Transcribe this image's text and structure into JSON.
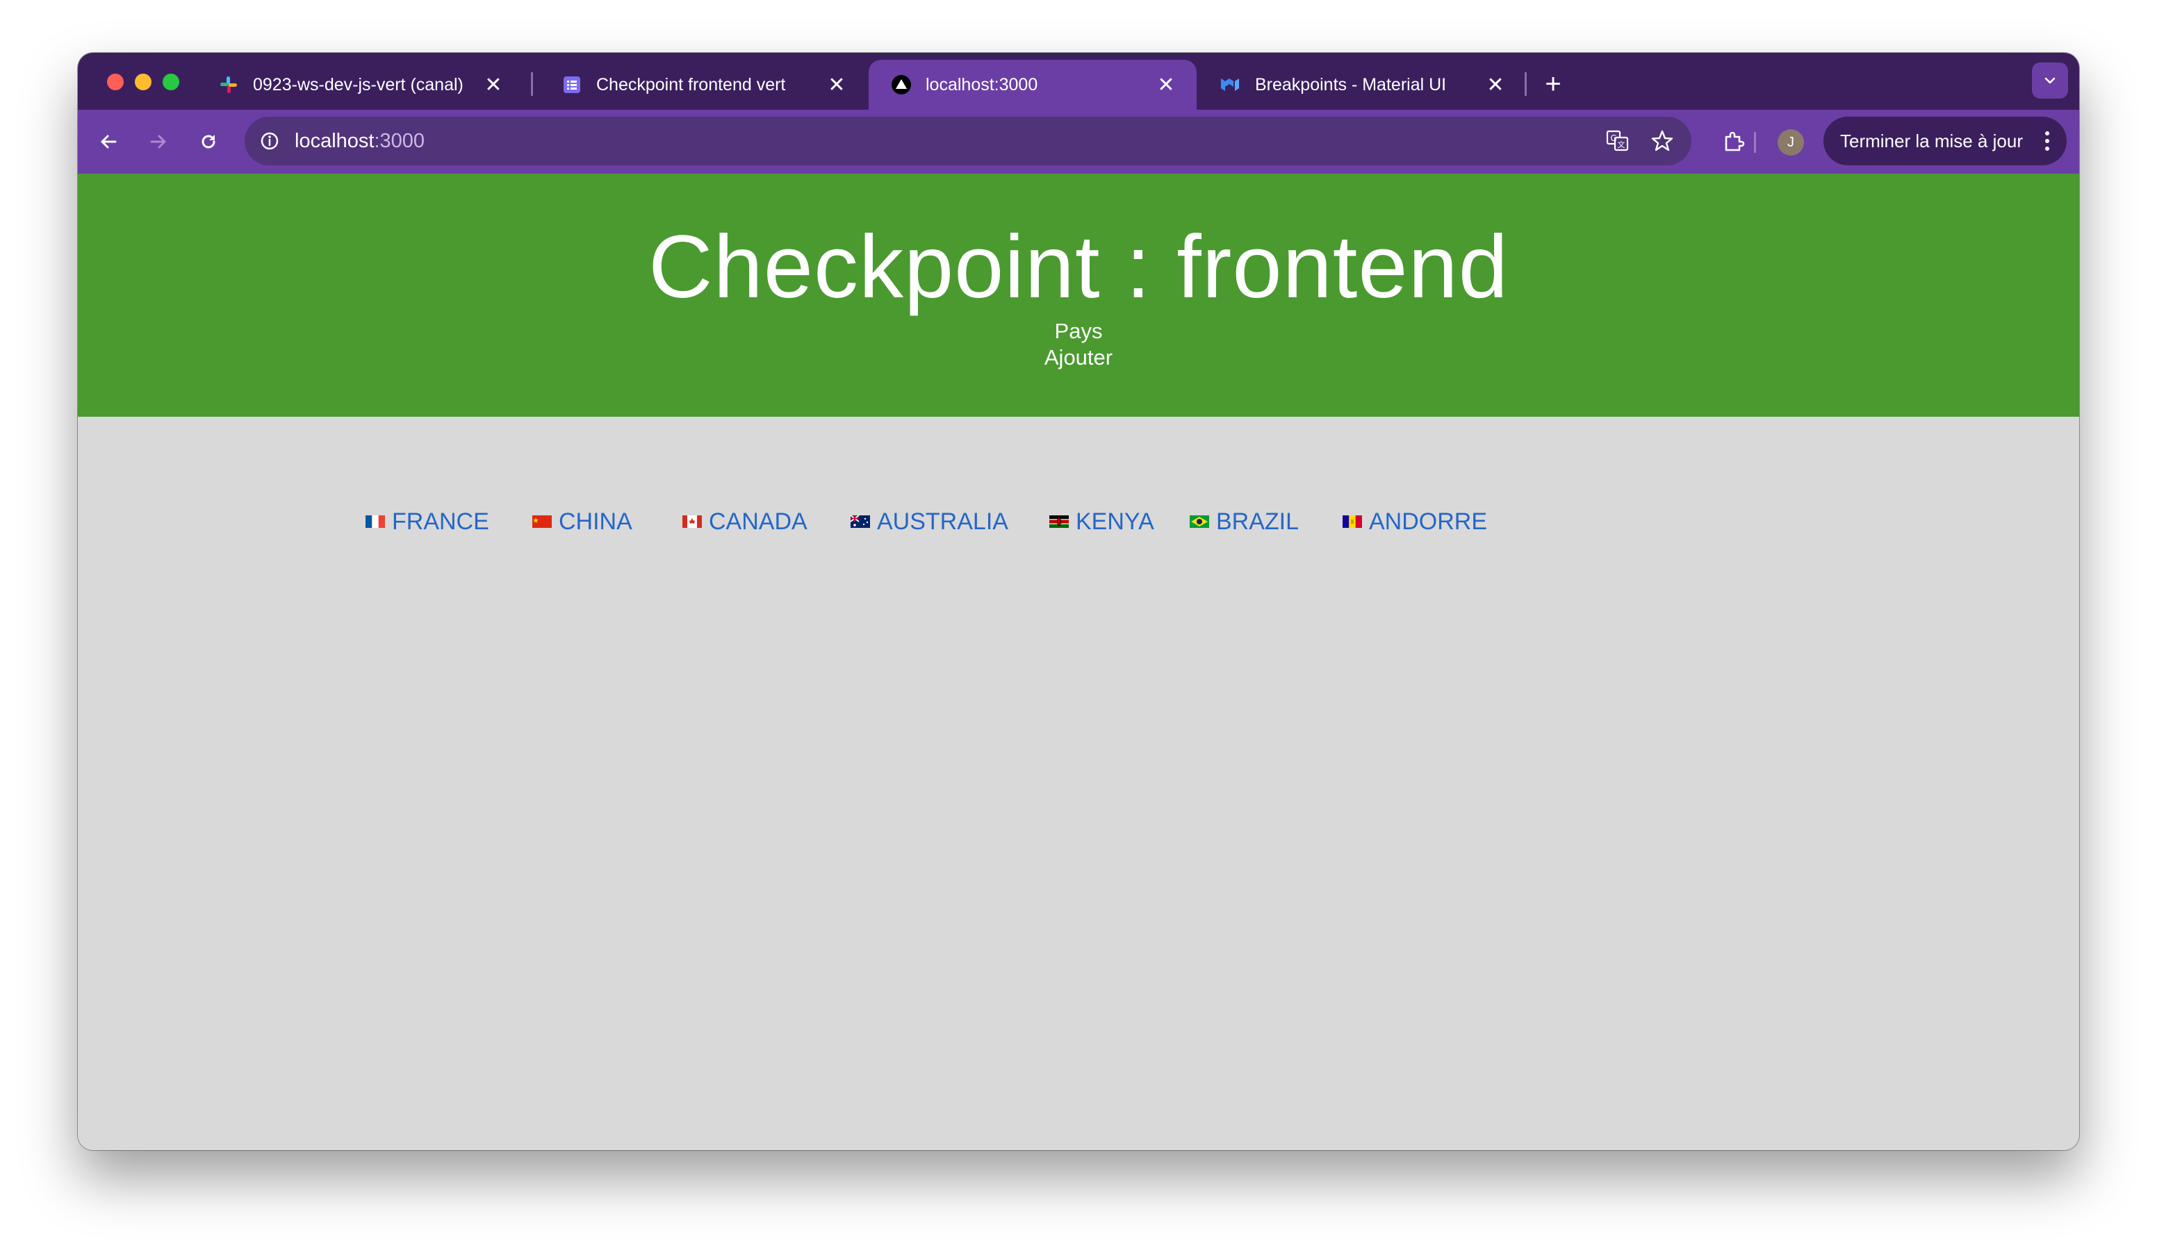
{
  "browser": {
    "tabs": [
      {
        "title": "0923-ws-dev-js-vert (canal)",
        "icon": "slack-icon",
        "active": false
      },
      {
        "title": "Checkpoint frontend vert",
        "icon": "list-doc-icon",
        "active": false
      },
      {
        "title": "localhost:3000",
        "icon": "triangle-logo-icon",
        "active": true
      },
      {
        "title": "Breakpoints - Material UI",
        "icon": "mui-logo-icon",
        "active": false
      }
    ],
    "close_glyph": "✕",
    "new_tab_glyph": "+",
    "url_host": "localhost",
    "url_port": ":3000",
    "avatar_initial": "J",
    "update_label": "Terminer la mise à jour"
  },
  "page": {
    "title": "Checkpoint : frontend",
    "nav": {
      "pays": "Pays",
      "ajouter": "Ajouter"
    },
    "countries": [
      {
        "name": "FRANCE",
        "flag": "flag-fr"
      },
      {
        "name": "CHINA",
        "flag": "flag-cn"
      },
      {
        "name": "CANADA",
        "flag": "flag-ca"
      },
      {
        "name": "AUSTRALIA",
        "flag": "flag-au"
      },
      {
        "name": "KENYA",
        "flag": "flag-ke"
      },
      {
        "name": "BRAZIL",
        "flag": "flag-br"
      },
      {
        "name": "ANDORRE",
        "flag": "flag-ad"
      }
    ]
  },
  "colors": {
    "tabstrip": "#3b1f5d",
    "toolbar": "#6a3ea4",
    "header_green": "#4a9a30",
    "page_bg": "#d9d9d9",
    "link_blue": "#2466c9"
  }
}
